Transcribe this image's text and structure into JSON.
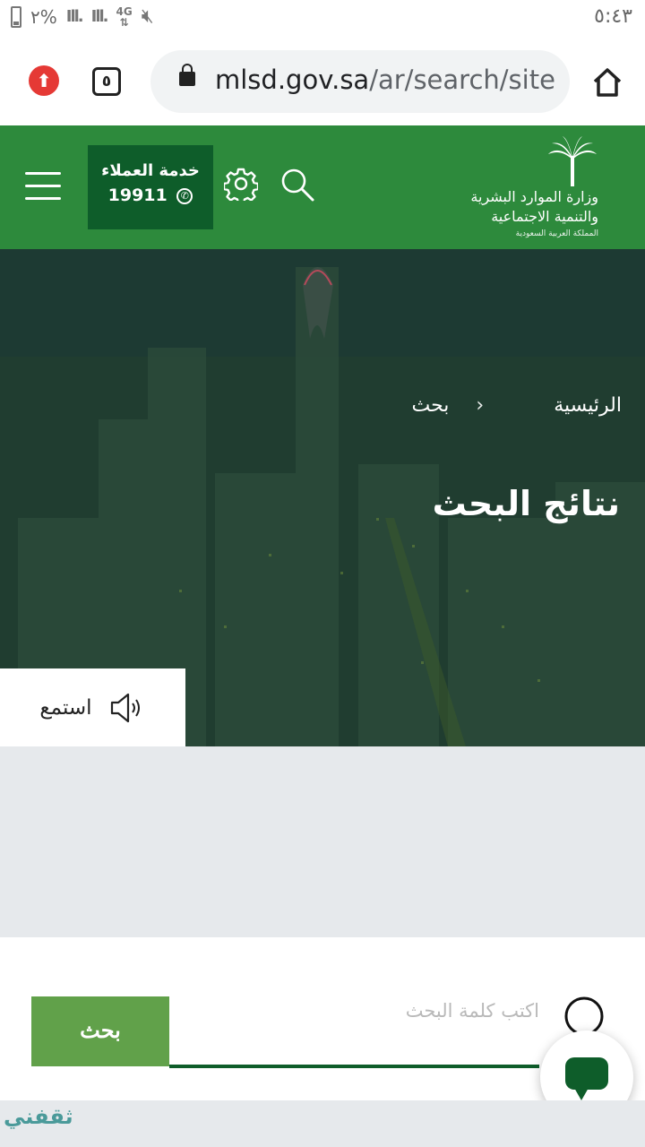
{
  "status_bar": {
    "time": "٥:٤٣",
    "battery_percent": "٢%",
    "network": "4G"
  },
  "browser": {
    "tab_count": "٥",
    "url_domain": "mlsd.gov.sa",
    "url_path": "/ar/search/site"
  },
  "header": {
    "ministry_line1": "وزارة الموارد البشرية",
    "ministry_line2": "والتنمية الاجتماعية",
    "ministry_line3": "المملكة العربية السعودية",
    "customer_service_label": "خدمة العملاء",
    "customer_service_number": "19911",
    "brand_color": "#2d8a3c",
    "dark_green": "#0e5d2a"
  },
  "hero": {
    "breadcrumb_home": "الرئيسية",
    "breadcrumb_current": "بحث",
    "title": "نتائج البحث",
    "listen_label": "استمع"
  },
  "search": {
    "placeholder": "اكتب كلمة البحث",
    "button_label": "بحث",
    "button_color": "#61a14a"
  },
  "watermark": "ثقفني"
}
